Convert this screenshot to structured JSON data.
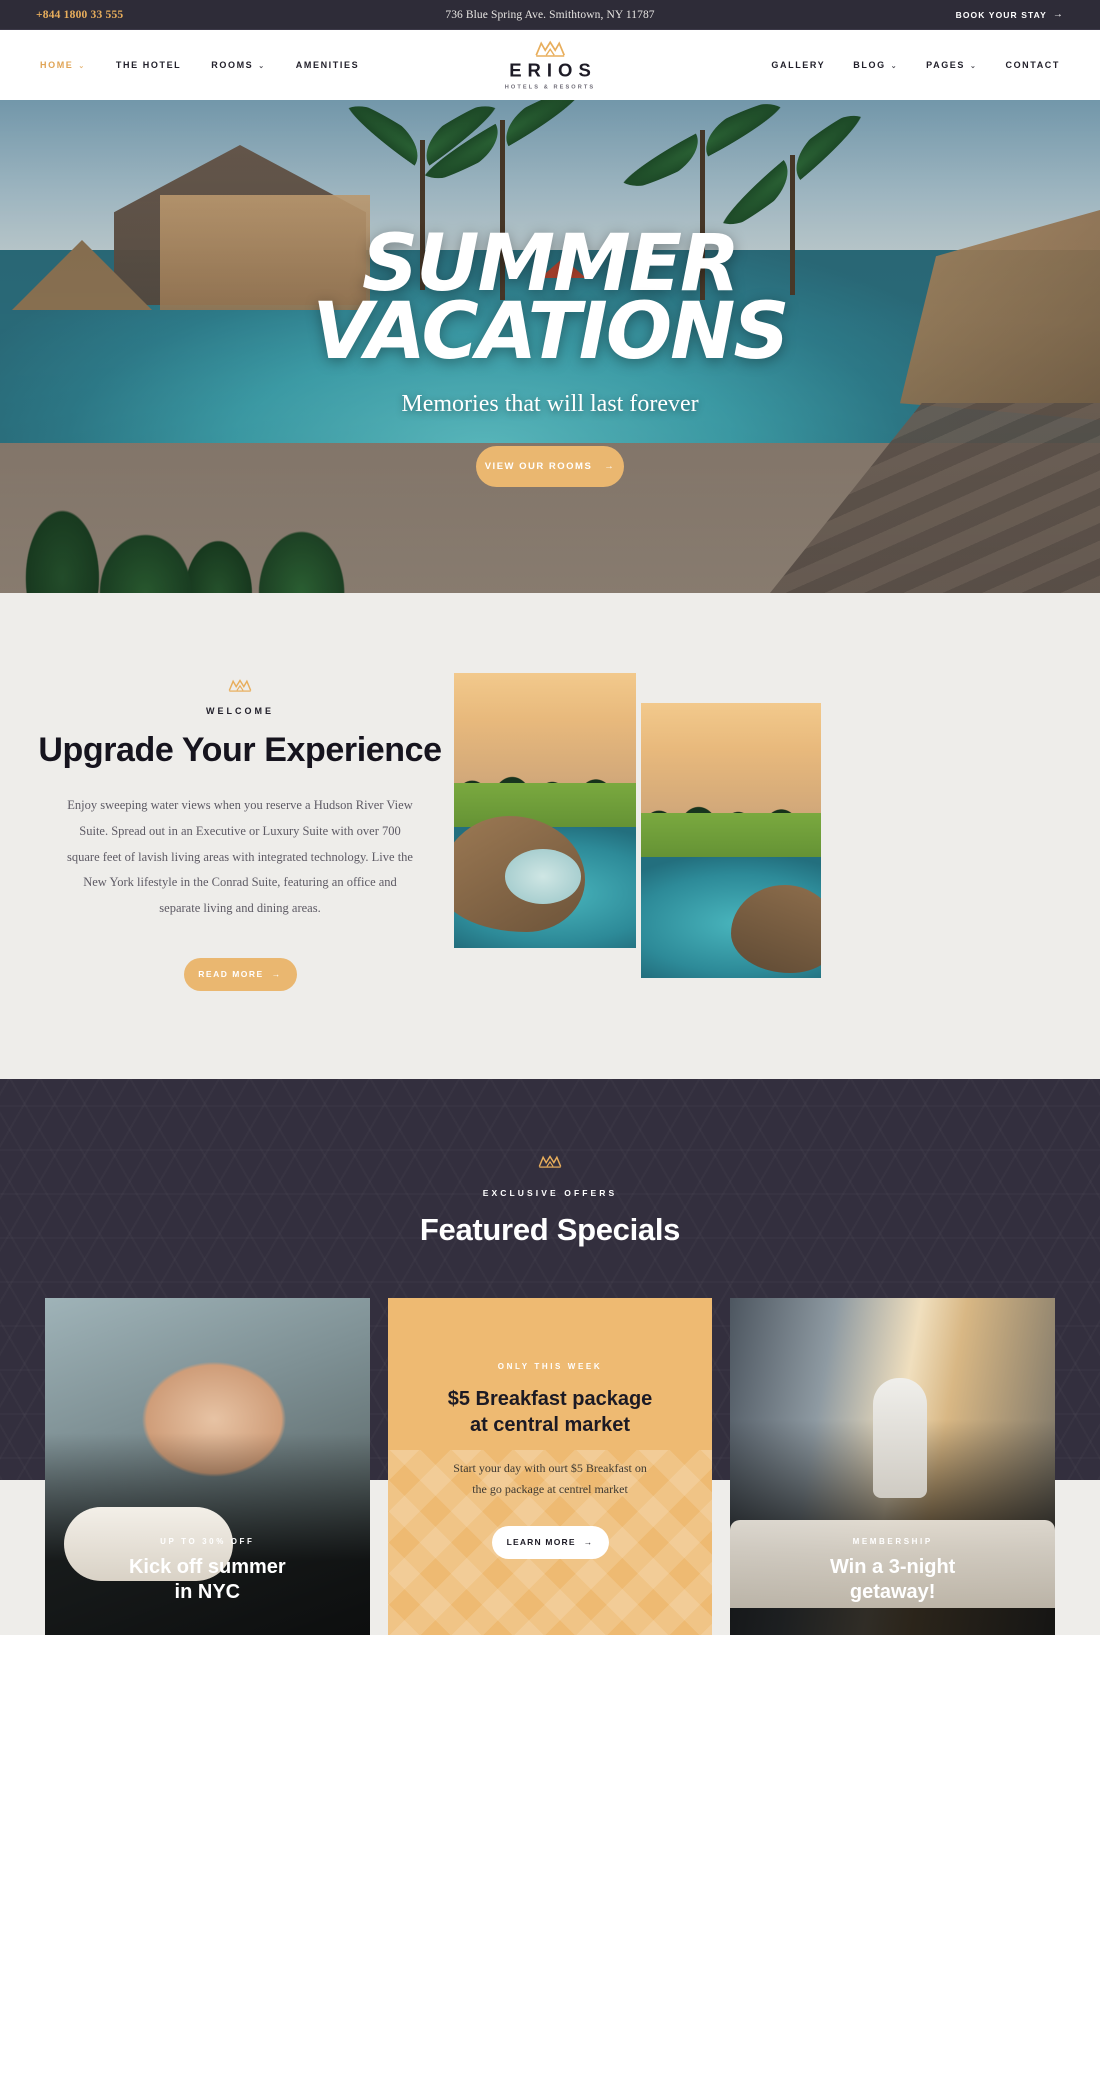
{
  "topbar": {
    "phone": "+844 1800 33 555",
    "address": "736 Blue Spring Ave. Smithtown, NY 11787",
    "cta": "BOOK YOUR STAY",
    "arrow": "→"
  },
  "nav": {
    "left_items": [
      {
        "label": "HOME",
        "has_caret": true,
        "active": true
      },
      {
        "label": "THE HOTEL",
        "has_caret": false,
        "active": false
      },
      {
        "label": "ROOMS",
        "has_caret": true,
        "active": false
      },
      {
        "label": "AMENITIES",
        "has_caret": false,
        "active": false
      }
    ],
    "right_items": [
      {
        "label": "GALLERY",
        "has_caret": false
      },
      {
        "label": "BLOG",
        "has_caret": true
      },
      {
        "label": "PAGES",
        "has_caret": true
      },
      {
        "label": "CONTACT",
        "has_caret": false
      }
    ],
    "logo_name": "ERIOS",
    "logo_sub": "HOTELS & RESORTS",
    "caret_glyph": "⌄"
  },
  "hero": {
    "title_line1": "SUMMER",
    "title_line2": "VACATIONS",
    "subtitle": "Memories that will last forever",
    "button": "VIEW OUR ROOMS",
    "arrow": "→"
  },
  "welcome": {
    "eyebrow": "WELCOME",
    "heading": "Upgrade Your Experience",
    "paragraph": "Enjoy sweeping water views when you reserve a Hudson River View Suite. Spread out in an Executive or Luxury Suite with over 700 square feet of lavish living areas with integrated technology. Live the New York lifestyle in the Conrad Suite, featuring an office and separate living and dining areas.",
    "button": "READ MORE",
    "arrow": "→"
  },
  "specials": {
    "eyebrow": "EXCLUSIVE OFFERS",
    "heading": "Featured Specials",
    "cards": [
      {
        "type": "photo",
        "eyebrow": "UP TO 30% OFF",
        "title_line1": "Kick off summer",
        "title_line2": "in NYC"
      },
      {
        "type": "gold",
        "eyebrow": "ONLY THIS WEEK",
        "title_line1": "$5 Breakfast package",
        "title_line2": "at central market",
        "text_line1": "Start your day with ourt $5 Breakfast on",
        "text_line2": "the go package at centrel market",
        "button": "LEARN MORE",
        "arrow": "→"
      },
      {
        "type": "photo",
        "eyebrow": "MEMBERSHIP",
        "title_line1": "Win a 3-night",
        "title_line2": "getaway!"
      }
    ]
  },
  "colors": {
    "gold": "#eab770",
    "gold_card": "#eeba72",
    "dark": "#332f3e",
    "topbar": "#2e2c38",
    "cream": "#eeedea",
    "accent_text": "#e0a455"
  }
}
